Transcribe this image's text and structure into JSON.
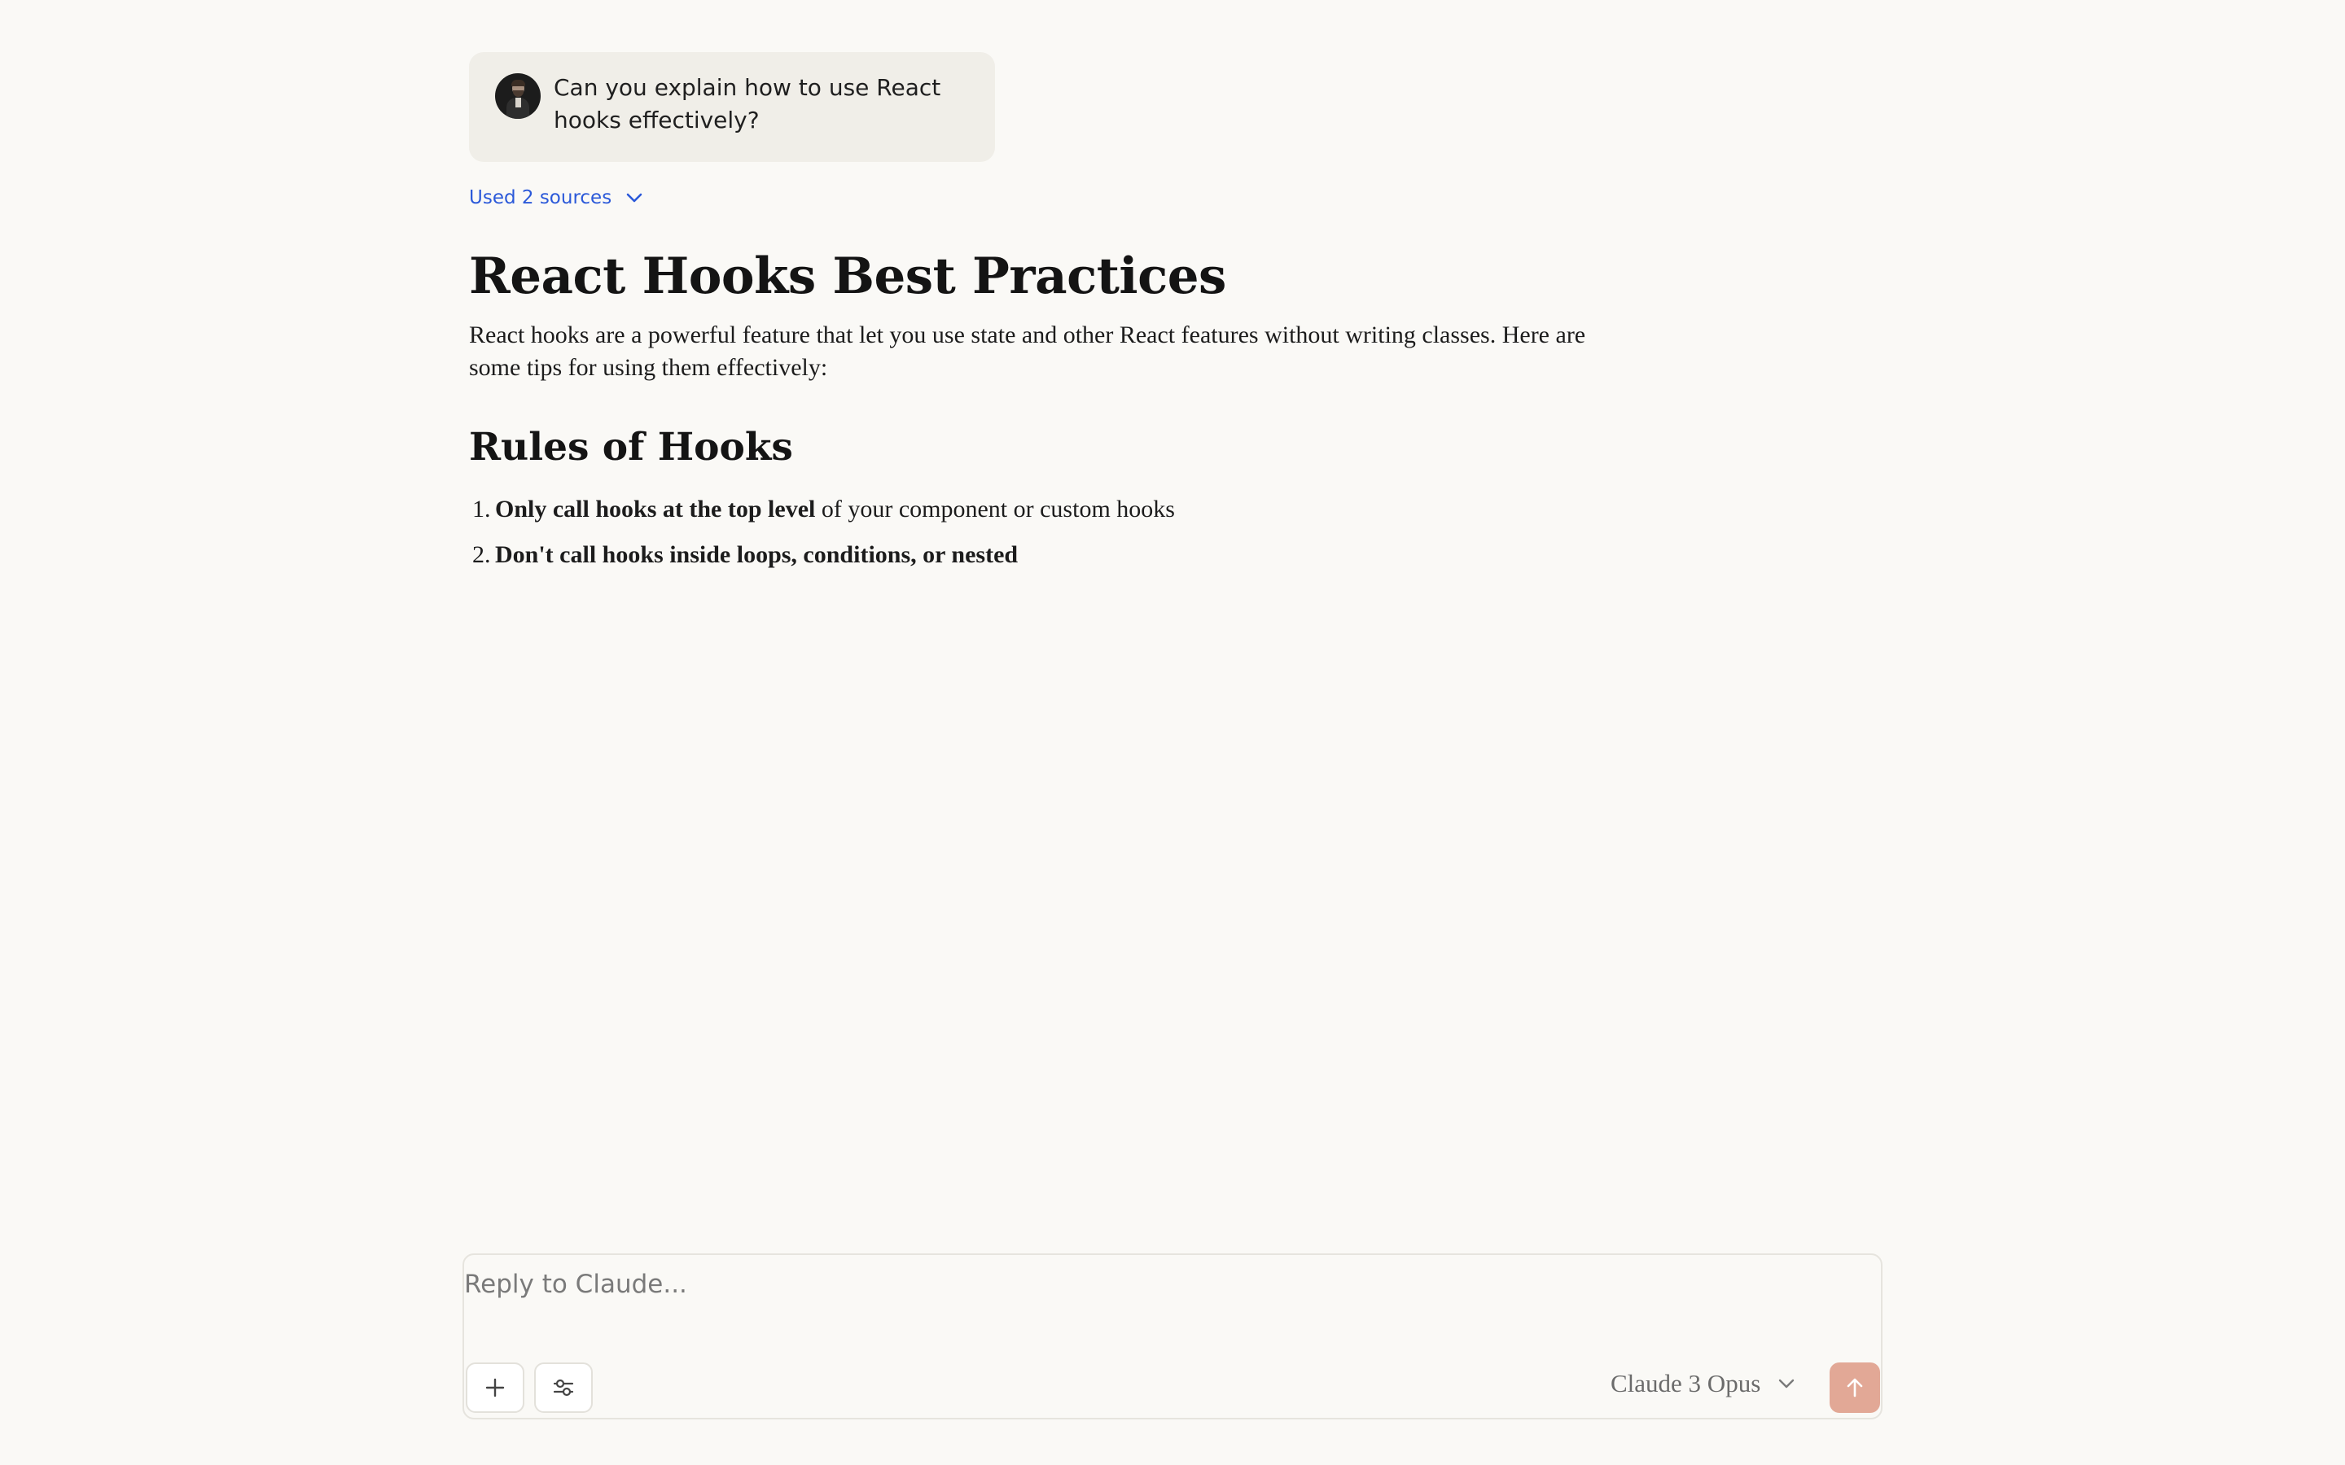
{
  "user_message": {
    "text": "Can you explain how to use React hooks effectively?"
  },
  "sources": {
    "label": "Used 2 sources",
    "icon": "chevron-down-icon"
  },
  "response": {
    "title": "React Hooks Best Practices",
    "intro": "React hooks are a powerful feature that let you use state and other React features without writing classes. Here are some tips for using them effectively:",
    "section_heading": "Rules of Hooks",
    "rules": [
      {
        "number": "1.",
        "bold": "Only call hooks at the top level",
        "rest": " of your component or custom hooks"
      },
      {
        "number": "2.",
        "bold": "Don't call hooks inside loops, conditions, or nested",
        "rest": ""
      }
    ]
  },
  "composer": {
    "placeholder": "Reply to Claude...",
    "add_icon": "plus-icon",
    "settings_icon": "sliders-icon",
    "model": "Claude 3 Opus",
    "model_icon": "chevron-down-icon",
    "send_icon": "arrow-up-icon"
  },
  "colors": {
    "background": "#faf9f6",
    "user_bubble": "#f0eee8",
    "link": "#2b59d9",
    "send_button": "#e2a896"
  }
}
